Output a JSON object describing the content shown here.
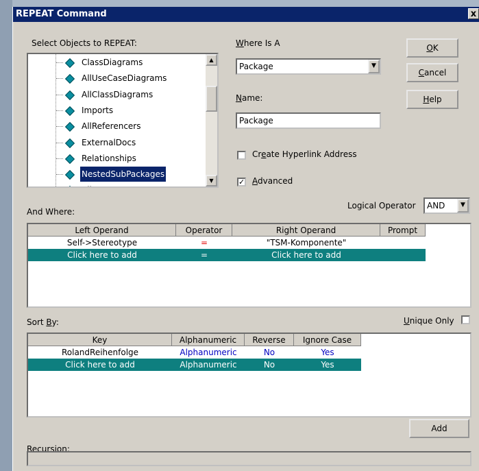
{
  "window": {
    "title": "REPEAT Command",
    "close": "x"
  },
  "select_objects": {
    "label": "Select Objects to REPEAT:",
    "items": [
      "ClassDiagrams",
      "AllUseCaseDiagrams",
      "AllClassDiagrams",
      "Imports",
      "AllReferencers",
      "ExternalDocs",
      "Relationships",
      "NestedSubPackages",
      "AllUseC..."
    ],
    "selected_index": 7
  },
  "where_is_a": {
    "label": "Where Is A",
    "value": "Package"
  },
  "name": {
    "label": "Name:",
    "value": "Package"
  },
  "create_hyperlink": {
    "label": "Create Hyperlink Address",
    "checked": false
  },
  "advanced": {
    "label": "Advanced",
    "checked": true,
    "mark": "✓"
  },
  "buttons": {
    "ok": "OK",
    "cancel": "Cancel",
    "help": "Help",
    "add": "Add"
  },
  "and_where": {
    "label": "And Where:",
    "logical_operator_label": "Logical Operator",
    "logical_operator_value": "AND",
    "columns": [
      "Left Operand",
      "Operator",
      "Right Operand",
      "Prompt"
    ],
    "rows": [
      {
        "left": "Self->Stereotype",
        "op": "=",
        "right": "\"TSM-Komponente\"",
        "prompt": ""
      },
      {
        "left": "Click here to add",
        "op": "=",
        "right": "Click here to add",
        "prompt": ""
      }
    ]
  },
  "sort_by": {
    "label": "Sort By:",
    "unique_only_label": "Unique Only",
    "unique_only_checked": false,
    "columns": [
      "Key",
      "Alphanumeric",
      "Reverse",
      "Ignore Case"
    ],
    "rows": [
      {
        "key": "RolandReihenfolge",
        "alpha": "Alphanumeric",
        "reverse": "No",
        "ignore": "Yes"
      },
      {
        "key": "Click here to add",
        "alpha": "Alphanumeric",
        "reverse": "No",
        "ignore": "Yes"
      }
    ]
  },
  "recursion": {
    "label": "Recursion:",
    "value": ""
  }
}
